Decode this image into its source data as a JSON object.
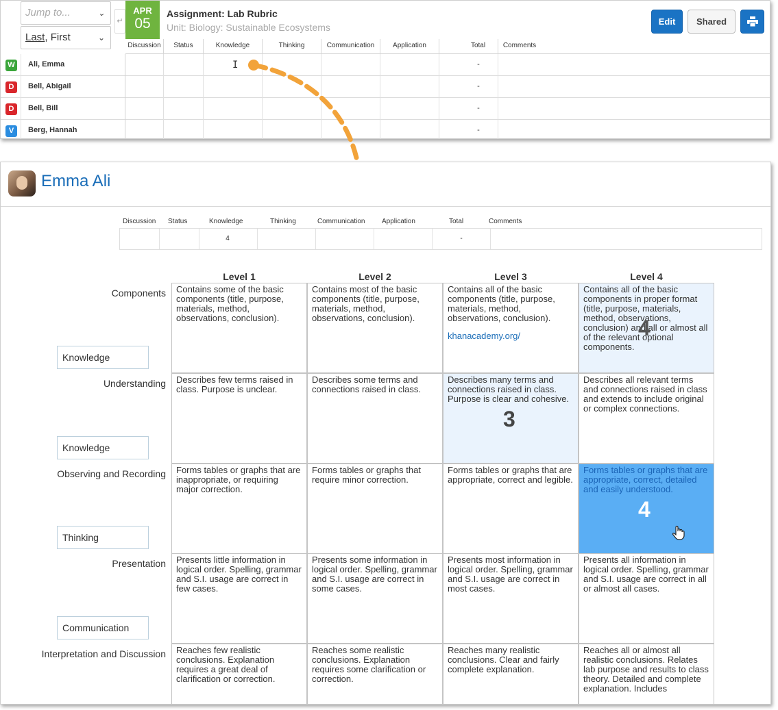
{
  "gradebook": {
    "jump_placeholder": "Jump to...",
    "sort_label_a": "Last",
    "sort_label_b": ", First",
    "date_month": "APR",
    "date_day": "05",
    "assignment_title": "Assignment: Lab Rubric",
    "unit": "Unit: Biology: Sustainable Ecosystems",
    "edit_label": "Edit",
    "shared_label": "Shared",
    "columns": [
      "Discussion",
      "Status",
      "Knowledge",
      "Thinking",
      "Communication",
      "Application",
      "Total",
      "Comments"
    ],
    "students": [
      {
        "badge": "W",
        "badge_color": "#3aa53a",
        "name": "Ali, Emma",
        "total": "-"
      },
      {
        "badge": "D",
        "badge_color": "#d9262b",
        "name": "Bell, Abigail",
        "total": "-"
      },
      {
        "badge": "D",
        "badge_color": "#d9262b",
        "name": "Bell, Bill",
        "total": "-"
      },
      {
        "badge": "V",
        "badge_color": "#2b8de0",
        "name": "Berg, Hannah",
        "total": "-"
      }
    ]
  },
  "detail": {
    "student_name": "Emma Ali",
    "columns": [
      "Discussion",
      "Status",
      "Knowledge",
      "Thinking",
      "Communication",
      "Application",
      "Total",
      "Comments"
    ],
    "knowledge_value": "4",
    "total_value": "-",
    "levels": [
      "Level 1",
      "Level 2",
      "Level 3",
      "Level 4"
    ],
    "criteria": [
      {
        "name": "Components",
        "category": "Knowledge",
        "cells": [
          "Contains some of the basic components (title, purpose, materials, method, observations, conclusion).",
          "Contains most of the basic components (title, purpose, materials, method, observations, conclusion).",
          "Contains all of the basic components (title, purpose, materials, method, observations, conclusion).",
          "Contains all of the basic components in proper format (title, purpose, materials, method, observations, conclusion) and all or almost all of the relevant optional components."
        ],
        "link": "khanacademy.org/",
        "score": "4"
      },
      {
        "name": "Understanding",
        "category": "Knowledge",
        "cells": [
          "Describes few terms raised in class. Purpose is unclear.",
          "Describes some terms and connections raised in class.",
          "Describes many terms and connections raised in class. Purpose is clear and cohesive.",
          "Describes all relevant terms and connections raised in class and extends to include original or complex connections."
        ],
        "score": "3"
      },
      {
        "name": "Observing and Recording",
        "category": "Thinking",
        "cells": [
          "Forms tables or graphs that are inappropriate, or requiring major correction.",
          "Forms tables or graphs that require minor correction.",
          "Forms tables or graphs that are appropriate, correct and legible.",
          "Forms tables or graphs that are appropriate, correct, detailed and easily understood."
        ],
        "score": "4"
      },
      {
        "name": "Presentation",
        "category": "Communication",
        "cells": [
          "Presents little information in logical order. Spelling, grammar and S.I. usage are correct in few cases.",
          "Presents some information in logical order. Spelling, grammar and S.I. usage are correct in some cases.",
          "Presents most information in logical order. Spelling, grammar and S.I. usage are correct in most cases.",
          "Presents all information in logical order. Spelling, grammar and S.I. usage are correct in all or almost all cases."
        ]
      },
      {
        "name": "Interpretation and Discussion",
        "cells": [
          "Reaches few realistic conclusions. Explanation requires a great deal of clarification or correction.",
          "Reaches some realistic conclusions. Explanation requires some clarification or correction.",
          "Reaches many realistic conclusions. Clear and fairly complete explanation.",
          "Reaches all or almost all realistic conclusions. Relates lab purpose and results to class theory. Detailed and complete explanation. Includes"
        ]
      }
    ]
  }
}
